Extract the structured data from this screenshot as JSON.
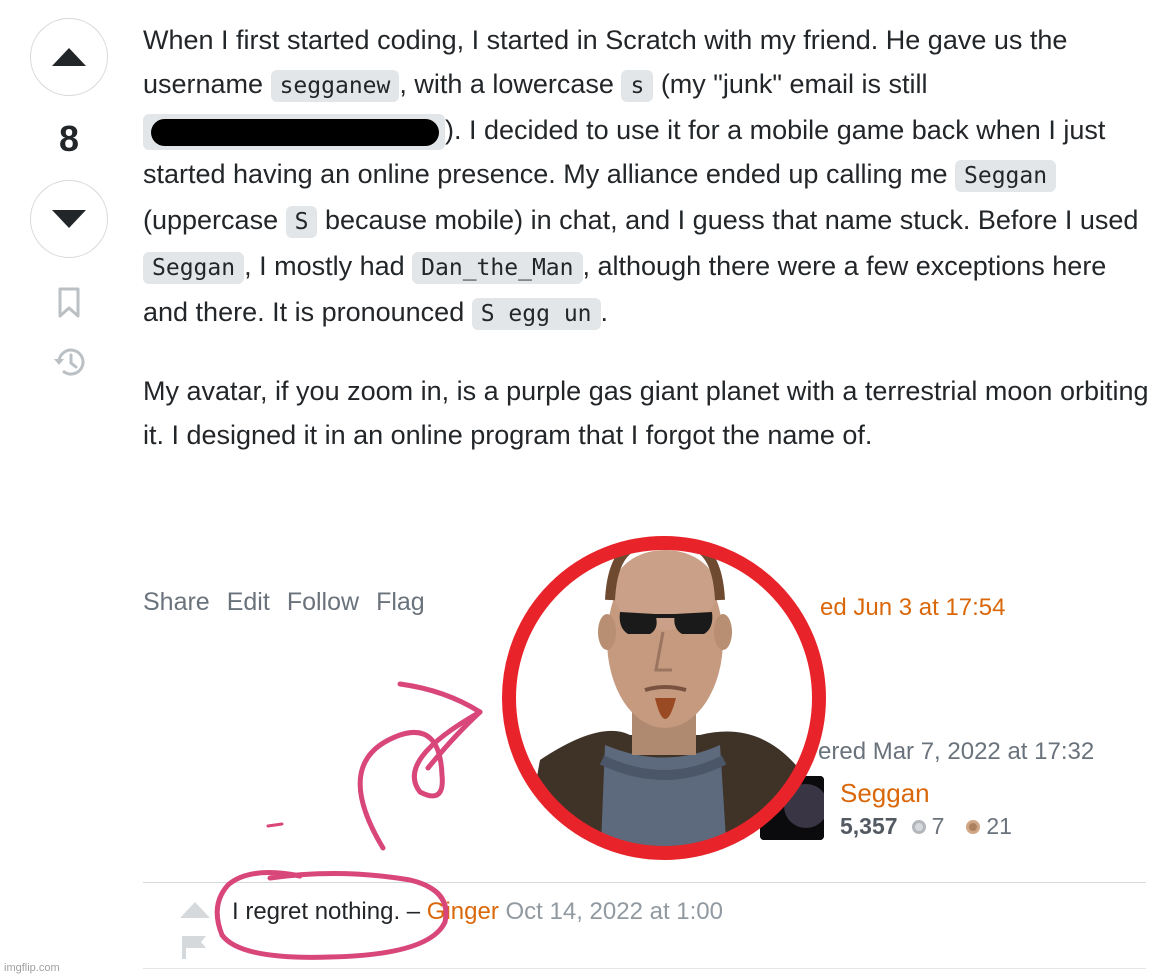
{
  "vote": {
    "count": "8"
  },
  "post": {
    "p1": {
      "t1": "When I first started coding, I started in Scratch with my friend. He gave us the username ",
      "c1": "segganew",
      "t2": ", with a lowercase ",
      "c2": "s",
      "t3": " (my \"junk\" email is still ",
      "t4": "). I decided to use it for a mobile game back when I just started having an online presence. My alliance ended up calling me ",
      "c3": "Seggan",
      "t5": " (uppercase ",
      "c4": "S",
      "t6": " because mobile) in chat, and I guess that name stuck. Before I used ",
      "c5": "Seggan",
      "t7": ", I mostly had ",
      "c6": "Dan_the_Man",
      "t8": ", although there were a few exceptions here and there. It is pronounced ",
      "c7": "S egg un",
      "t9": "."
    },
    "p2": "My avatar, if you zoom in, is a purple gas giant planet with a terrestrial moon orbiting it. I designed it in an online program that I forgot the name of."
  },
  "menu": {
    "share": "Share",
    "edit": "Edit",
    "follow": "Follow",
    "flag": "Flag"
  },
  "edited": "ed Jun 3 at 17:54",
  "answered": "ered Mar 7, 2022 at 17:32",
  "user": {
    "name": "Seggan",
    "reputation": "5,357",
    "silver": "7",
    "bronze": "21"
  },
  "comment": {
    "text": "I regret nothing.",
    "dash": " – ",
    "author": "Ginger",
    "date": "Oct 14, 2022 at 1:00"
  },
  "watermark": "imgflip.com",
  "colors": {
    "accent": "#da680b",
    "meme_circle": "#e8232a",
    "meme_ink": "#d8467a"
  },
  "icons": {
    "upvote": "triangle-up-icon",
    "downvote": "triangle-down-icon",
    "bookmark": "bookmark-icon",
    "history": "history-icon",
    "flag": "flag-icon"
  }
}
